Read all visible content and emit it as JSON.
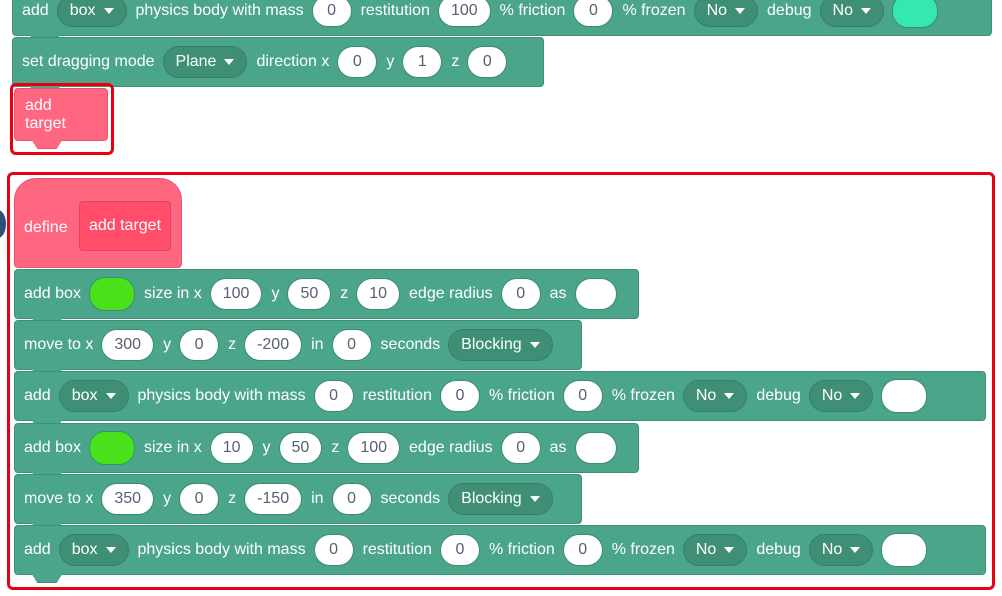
{
  "top_block": {
    "add": "add",
    "shape": "box",
    "mass_label": "physics body with mass",
    "mass": "0",
    "restitution_label": "restitution",
    "restitution": "100",
    "friction_label": "% friction",
    "friction": "0",
    "frozen_label": "% frozen",
    "frozen": "No",
    "debug_label": "debug",
    "debug": "No",
    "color": "#34e8b0"
  },
  "drag_block": {
    "label": "set dragging mode",
    "mode": "Plane",
    "direction_label": "direction x",
    "x": "0",
    "y_label": "y",
    "y": "1",
    "z_label": "z",
    "z": "0"
  },
  "call_block": {
    "label": "add target"
  },
  "define_block": {
    "define": "define",
    "name": "add target"
  },
  "add_box_1": {
    "label": "add box",
    "color": "#4be11a",
    "size_label": "size in x",
    "x": "100",
    "y_label": "y",
    "y": "50",
    "z_label": "z",
    "z": "10",
    "edge_label": "edge radius",
    "edge": "0",
    "as_label": "as"
  },
  "move_1": {
    "label": "move to x",
    "x": "300",
    "y_label": "y",
    "y": "0",
    "z_label": "z",
    "z": "-200",
    "in_label": "in",
    "secs": "0",
    "secs_label": "seconds",
    "mode": "Blocking"
  },
  "physics_1": {
    "add": "add",
    "shape": "box",
    "mass_label": "physics body with mass",
    "mass": "0",
    "restitution_label": "restitution",
    "restitution": "0",
    "friction_label": "% friction",
    "friction": "0",
    "frozen_label": "% frozen",
    "frozen": "No",
    "debug_label": "debug",
    "debug": "No"
  },
  "add_box_2": {
    "label": "add box",
    "color": "#4be11a",
    "size_label": "size in x",
    "x": "10",
    "y_label": "y",
    "y": "50",
    "z_label": "z",
    "z": "100",
    "edge_label": "edge radius",
    "edge": "0",
    "as_label": "as"
  },
  "move_2": {
    "label": "move to x",
    "x": "350",
    "y_label": "y",
    "y": "0",
    "z_label": "z",
    "z": "-150",
    "in_label": "in",
    "secs": "0",
    "secs_label": "seconds",
    "mode": "Blocking"
  },
  "physics_2": {
    "add": "add",
    "shape": "box",
    "mass_label": "physics body with mass",
    "mass": "0",
    "restitution_label": "restitution",
    "restitution": "0",
    "friction_label": "% friction",
    "friction": "0",
    "frozen_label": "% frozen",
    "frozen": "No",
    "debug_label": "debug",
    "debug": "No"
  }
}
